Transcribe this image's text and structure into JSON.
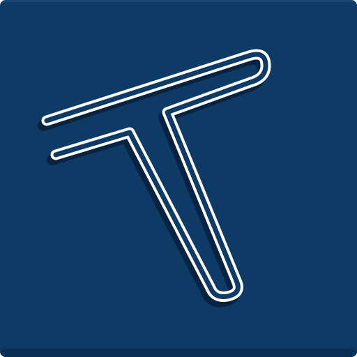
{
  "app_icon": {
    "icon": "letter-t-logo-icon",
    "colors": {
      "background": "#0e3a66",
      "background_edge": "#0b2f54",
      "outline": "#ffffff",
      "shadow": "#061c33"
    }
  }
}
